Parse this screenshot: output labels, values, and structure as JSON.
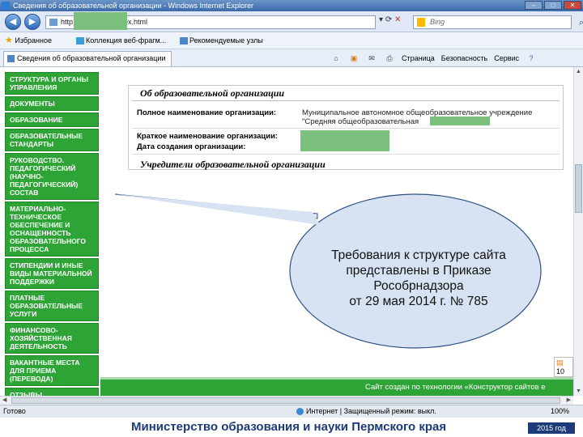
{
  "window": {
    "title": "Сведения об образовательной организации - Windows Internet Explorer",
    "controls": [
      "–",
      "□",
      "✕"
    ]
  },
  "address": {
    "url": "http://          site.ru/cs_index.html",
    "bing_placeholder": "Bing",
    "nav_back_icon": "back-arrow-icon",
    "nav_forward_icon": "forward-arrow-icon"
  },
  "favorites": {
    "label": "Избранное",
    "items": [
      "Коллекция веб-фрагм...",
      "Рекомендуемые узлы"
    ]
  },
  "tab": {
    "title": "Сведения об образовательной организации"
  },
  "commands": [
    "Страница",
    "Безопасность",
    "Сервис"
  ],
  "sidebar": {
    "items": [
      "Структура и органы управления",
      "Документы",
      "Образование",
      "Образовательные стандарты",
      "Руководство. Педагогический (научно-педагогический) состав",
      "Материально-техническое обеспечение и оснащенность образовательного процесса",
      "Стипендии и иные виды материальной поддержки",
      "Платные образовательные услуги",
      "Финансово-хозяйственная деятельность",
      "Вакантные места для приема (перевода)",
      "Отзывы"
    ]
  },
  "org": {
    "section_title": "Об образовательной организации",
    "full_name_label": "Полное наименование организации:",
    "full_name_value_1": "Муниципальное автономное общеобразовательное учреждение",
    "full_name_value_2": "\"Средняя общеобразовательная",
    "short_name_label": "Краткое наименование организации:",
    "date_label": "Дата создания организации:",
    "founders_title": "Учредители образовательной организации"
  },
  "footer": {
    "text": "Сайт создан по технологии «Конструктор сайтов е"
  },
  "badge": "10",
  "callout": {
    "lines": [
      "Требования к  структуре сайта",
      "представлены в Приказе",
      "Рособрнадзора",
      "от 29 мая 2014 г. № 785"
    ]
  },
  "status": {
    "ready": "Готово",
    "zone": "Интернет | Защищенный режим: выкл.",
    "zoom": "100%"
  },
  "banner": {
    "title": "Министерство образования и науки Пермского края",
    "year": "2015 год"
  },
  "colors": {
    "sidebar_green": "#2ea336",
    "banner_blue": "#1c3b78",
    "redaction_green": "#7bc07c"
  }
}
